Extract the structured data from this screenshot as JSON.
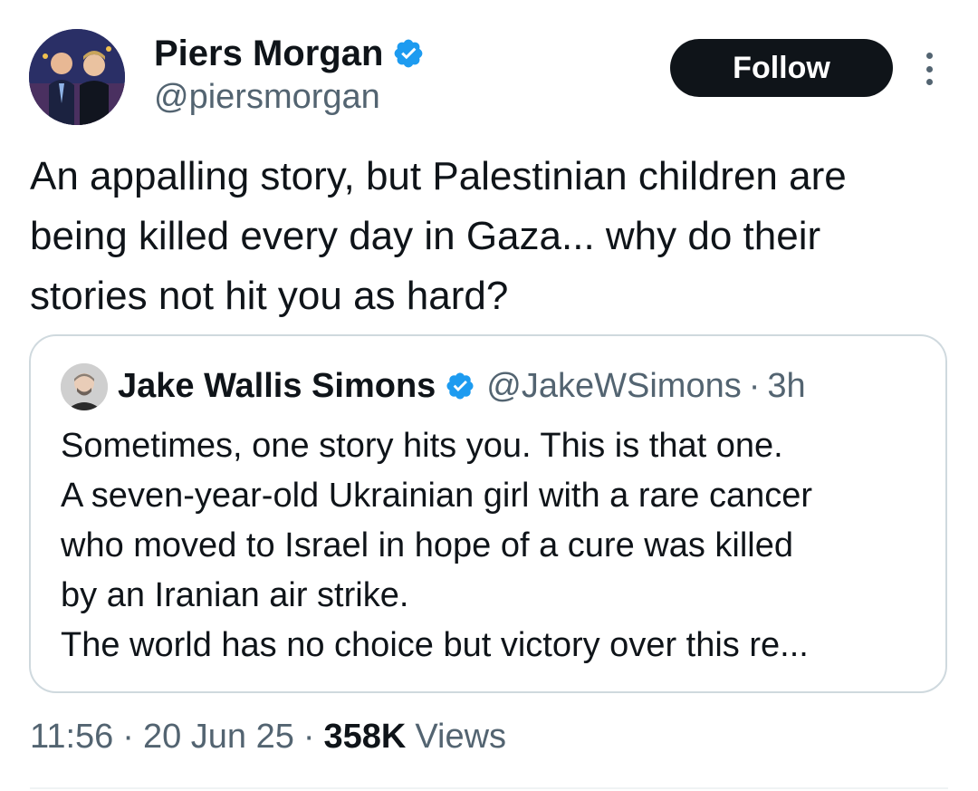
{
  "tweet": {
    "author": {
      "name": "Piers Morgan",
      "handle": "@piersmorgan",
      "verified": true
    },
    "follow_label": "Follow",
    "text": "An appalling story, but Palestinian children are being killed every day in Gaza... why do their stories not hit you as hard?",
    "quoted": {
      "name": "Jake Wallis Simons",
      "handle": "@JakeWSimons",
      "separator": "·",
      "time": "3h",
      "verified": true,
      "lines": [
        "Sometimes, one story hits you. This is that one.",
        "A seven-year-old Ukrainian girl with a rare cancer",
        "who moved to Israel in hope of a cure was killed",
        "by an Iranian air strike.",
        "The world has no choice but victory over this re..."
      ]
    },
    "meta": {
      "time": "11:56",
      "separator": "·",
      "date": "20 Jun 25",
      "views_count": "358K",
      "views_label": "Views"
    }
  },
  "colors": {
    "text_primary": "#0f1419",
    "text_secondary": "#536471",
    "verified_blue": "#1d9bf0",
    "border": "#cfd9de",
    "follow_bg": "#0f1419"
  },
  "icons": {
    "verified": "verified-badge-icon",
    "more": "more-vertical-icon"
  }
}
